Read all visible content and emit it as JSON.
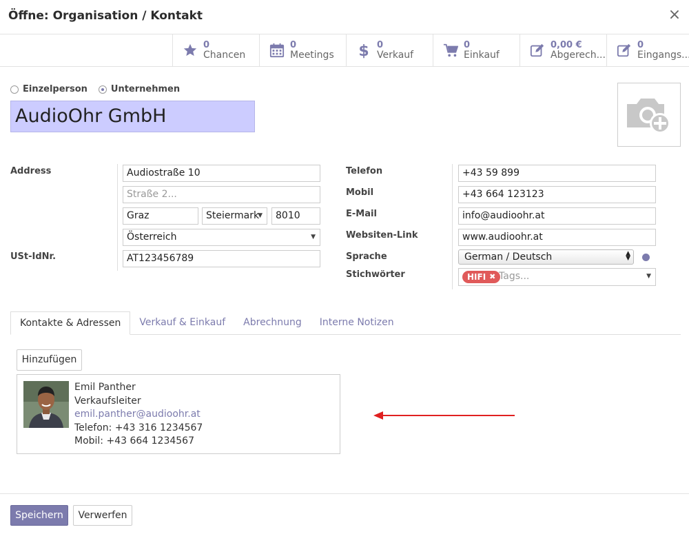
{
  "dialog": {
    "title": "Öffne: Organisation / Kontakt",
    "close": "×"
  },
  "smart_buttons": [
    {
      "count": "0",
      "label": "Chancen",
      "icon": "star-icon"
    },
    {
      "count": "0",
      "label": "Meetings",
      "icon": "calendar-icon"
    },
    {
      "count": "0",
      "label": "Verkauf",
      "icon": "dollar-icon"
    },
    {
      "count": "0",
      "label": "Einkauf",
      "icon": "cart-icon"
    },
    {
      "count": "0,00 €",
      "label": "Abgerech...",
      "icon": "edit-icon"
    },
    {
      "count": "0",
      "label": "Eingangs...",
      "icon": "edit-icon"
    }
  ],
  "company_type": {
    "person": "Einzelperson",
    "company": "Unternehmen",
    "selected": "Unternehmen"
  },
  "name": "AudioOhr GmbH",
  "labels": {
    "address": "Address",
    "vat": "USt-IdNr.",
    "phone": "Telefon",
    "mobile": "Mobil",
    "email": "E-Mail",
    "website": "Websiten-Link",
    "language": "Sprache",
    "tags": "Stichwörter"
  },
  "address": {
    "street": "Audiostraße 10",
    "street2_placeholder": "Straße 2...",
    "city": "Graz",
    "state": "Steiermark",
    "zip": "8010",
    "country": "Österreich"
  },
  "vat": "AT123456789",
  "contact": {
    "phone": "+43 59 899",
    "mobile": "+43 664 123123",
    "email": "info@audioohr.at",
    "website": "www.audioohr.at",
    "language": "German / Deutsch",
    "tag": "HIFI",
    "tags_placeholder": "Tags..."
  },
  "tabs": [
    "Kontakte & Adressen",
    "Verkauf & Einkauf",
    "Abrechnung",
    "Interne Notizen"
  ],
  "add_button": "Hinzufügen",
  "contact_card": {
    "name": "Emil Panther",
    "function": "Verkaufsleiter",
    "email": "emil.panther@audioohr.at",
    "phone": "Telefon: +43 316 1234567",
    "mobile": "Mobil: +43 664 1234567"
  },
  "footer": {
    "save": "Speichern",
    "discard": "Verwerfen"
  },
  "colors": {
    "accent": "#7c7bad",
    "name_bg": "#ccccff",
    "tag": "#e05a5a",
    "arrow": "#e02020"
  }
}
